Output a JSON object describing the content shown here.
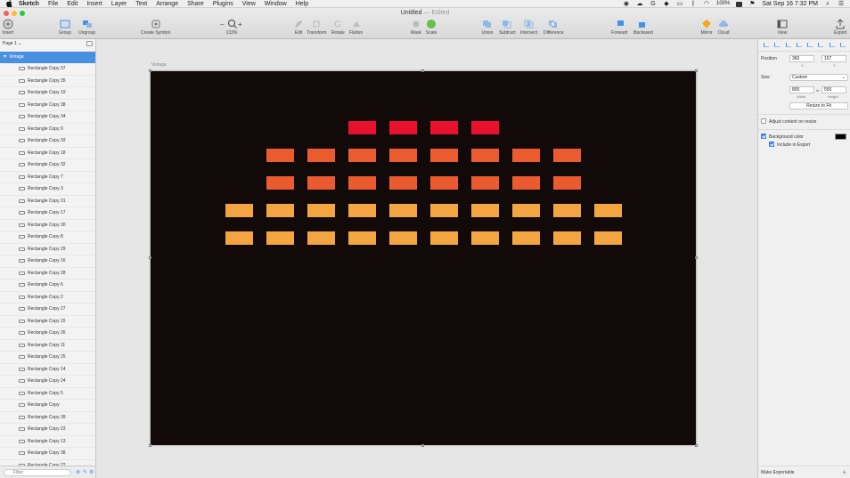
{
  "menubar": {
    "app": "Sketch",
    "items": [
      "File",
      "Edit",
      "Insert",
      "Layer",
      "Text",
      "Arrange",
      "Share",
      "Plugins",
      "View",
      "Window",
      "Help"
    ],
    "battery": "100%",
    "clock": "Sat Sep 16 7:32 PM"
  },
  "title": {
    "name": "Untitled",
    "status": "— Edited"
  },
  "toolbar": {
    "insert": "Insert",
    "group": "Group",
    "ungroup": "Ungroup",
    "create_symbol": "Create Symbol",
    "zoom": "133%",
    "edit": "Edit",
    "transform": "Transform",
    "rotate": "Rotate",
    "flatten": "Flatten",
    "mask": "Mask",
    "scale": "Scale",
    "union": "Union",
    "subtract": "Subtract",
    "intersect": "Intersect",
    "difference": "Difference",
    "forward": "Forward",
    "backward": "Backward",
    "mirror": "Mirror",
    "cloud": "Cloud",
    "view": "View",
    "export": "Export"
  },
  "layers": {
    "page": "Page 1",
    "artboard": "Vintage",
    "items": [
      "Rectangle Copy 37",
      "Rectangle Copy 35",
      "Rectangle Copy 19",
      "Rectangle Copy 38",
      "Rectangle Copy 34",
      "Rectangle Copy 9",
      "Rectangle Copy 33",
      "Rectangle Copy 18",
      "Rectangle Copy 32",
      "Rectangle Copy 7",
      "Rectangle Copy 3",
      "Rectangle Copy 31",
      "Rectangle Copy 17",
      "Rectangle Copy 30",
      "Rectangle Copy 8",
      "Rectangle Copy 29",
      "Rectangle Copy 16",
      "Rectangle Copy 28",
      "Rectangle Copy 6",
      "Rectangle Copy 2",
      "Rectangle Copy 27",
      "Rectangle Copy 15",
      "Rectangle Copy 26",
      "Rectangle Copy 11",
      "Rectangle Copy 25",
      "Rectangle Copy 14",
      "Rectangle Copy 24",
      "Rectangle Copy 5",
      "Rectangle Copy",
      "Rectangle Copy 39",
      "Rectangle Copy 23",
      "Rectangle Copy 13",
      "Rectangle Copy 38",
      "Rectangle Copy 22"
    ],
    "filter_placeholder": "Filter"
  },
  "canvas": {
    "artboard_label": "Vintage",
    "colors": {
      "background": "#120909",
      "red": "#e8112d",
      "orange_red": "#ea5b2f",
      "orange": "#f2a541"
    },
    "rows": [
      {
        "color": "#e8112d",
        "count": 4
      },
      {
        "color": "#ea5b2f",
        "count": 8
      },
      {
        "color": "#ea5b2f",
        "count": 8
      },
      {
        "color": "#f2a541",
        "count": 10
      },
      {
        "color": "#f2a541",
        "count": 10
      }
    ]
  },
  "inspector": {
    "position_label": "Position",
    "x_value": "360",
    "y_value": "157",
    "x_label": "X",
    "y_label": "Y",
    "size_label": "Size",
    "size_preset": "Custom",
    "width_value": "800",
    "height_value": "550",
    "width_label": "Width",
    "height_label": "Height",
    "resize_button": "Resize to Fit",
    "adjust_label": "Adjust content on resize",
    "bg_color_label": "Background color",
    "include_export_label": "Include in Export",
    "make_exportable": "Make Exportable"
  }
}
